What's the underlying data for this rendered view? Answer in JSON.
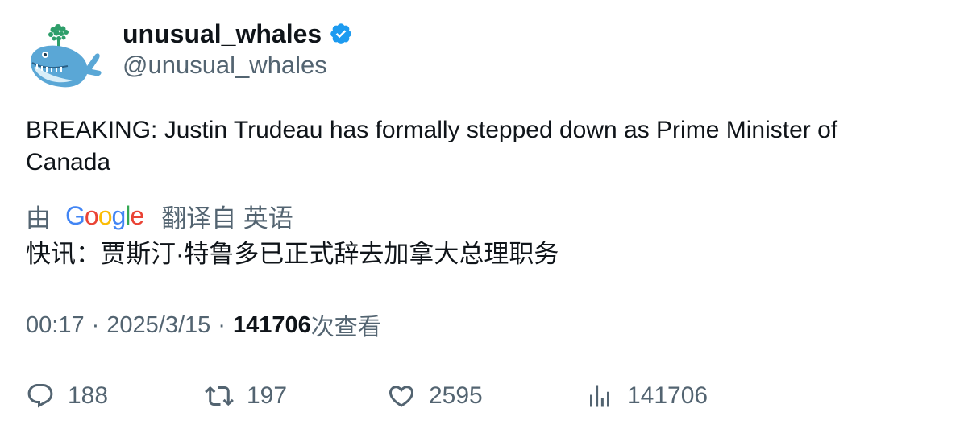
{
  "author": {
    "display_name": "unusual_whales",
    "handle": "@unusual_whales",
    "verified": true,
    "verified_color": "#1d9bf0"
  },
  "tweet": {
    "text": "BREAKING: Justin Trudeau has formally stepped down as Prime Minister of Canada"
  },
  "translation": {
    "prefix": "由",
    "provider": "Google",
    "suffix": "翻译自 英语",
    "text": "快讯：贾斯汀·特鲁多已正式辞去加拿大总理职务"
  },
  "meta": {
    "time": "00:17",
    "separator": "·",
    "date": "2025/3/15",
    "views_count": "141706",
    "views_label": "次查看"
  },
  "actions": {
    "reply_count": "188",
    "retweet_count": "197",
    "like_count": "2595",
    "views_count": "141706"
  },
  "icons": {
    "reply": "reply-icon",
    "retweet": "retweet-icon",
    "like": "heart-icon",
    "views": "analytics-icon",
    "verified": "verified-badge-icon",
    "avatar": "whale-avatar"
  },
  "colors": {
    "text_primary": "#0f1419",
    "text_secondary": "#536471",
    "accent": "#1d9bf0"
  }
}
